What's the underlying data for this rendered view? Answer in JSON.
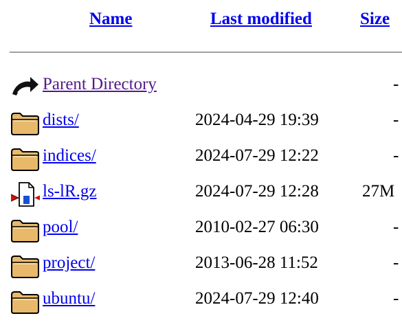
{
  "columns": {
    "name": "Name",
    "last_modified": "Last modified",
    "size": "Size"
  },
  "colors": {
    "link": "#0000ee",
    "visited_link": "#551a8b",
    "rule": "#a0a0a0"
  },
  "entries": [
    {
      "name": "Parent Directory",
      "date": "",
      "size": "-",
      "icon": "back-arrow-icon"
    },
    {
      "name": "dists/",
      "date": "2024-04-29 19:39",
      "size": "-",
      "icon": "folder-icon"
    },
    {
      "name": "indices/",
      "date": "2024-07-29 12:22",
      "size": "-",
      "icon": "folder-icon"
    },
    {
      "name": "ls-lR.gz",
      "date": "2024-07-29 12:28",
      "size": "27M",
      "icon": "compressed-file-icon"
    },
    {
      "name": "pool/",
      "date": "2010-02-27 06:30",
      "size": "-",
      "icon": "folder-icon"
    },
    {
      "name": "project/",
      "date": "2013-06-28 11:52",
      "size": "-",
      "icon": "folder-icon"
    },
    {
      "name": "ubuntu/",
      "date": "2024-07-29 12:40",
      "size": "-",
      "icon": "folder-icon"
    }
  ]
}
